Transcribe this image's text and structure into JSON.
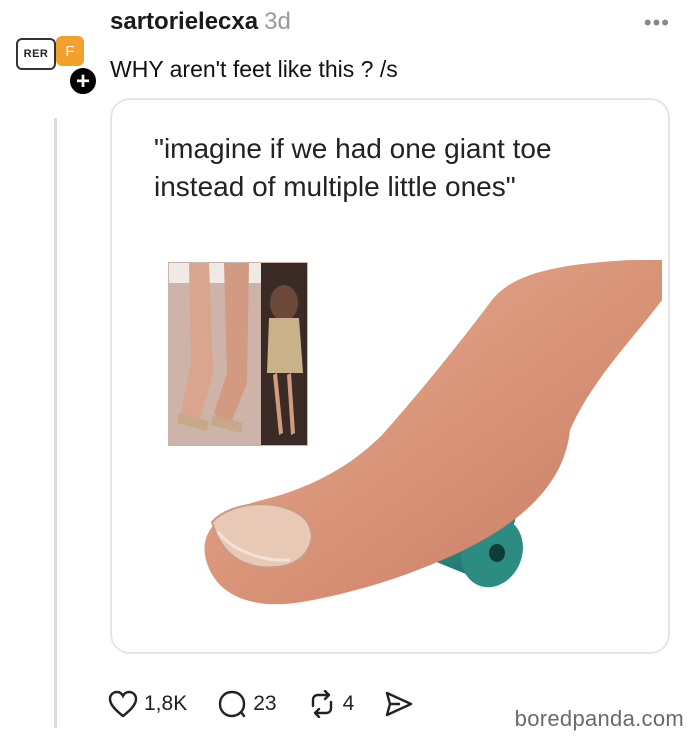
{
  "post": {
    "username": "sartorielecxa",
    "timestamp": "3d",
    "text": "WHY aren't feet like this ? /s",
    "avatar_label": "RER",
    "avatar_badge": "F",
    "follow_label": "+",
    "more_label": "•••"
  },
  "media": {
    "caption": "\"imagine if we had one giant toe instead of multiple little ones\""
  },
  "actions": {
    "likes": "1,8K",
    "replies": "23",
    "reposts": "4"
  },
  "icons": {
    "like": "heart-icon",
    "reply": "speech-bubble-icon",
    "repost": "repost-icon",
    "share": "send-icon"
  },
  "colors": {
    "badge": "#f2a12e",
    "teal_object": "#2e8f86"
  },
  "watermark": "boredpanda.com"
}
